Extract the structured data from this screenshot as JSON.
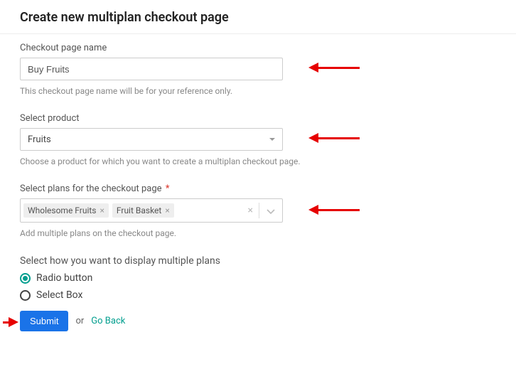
{
  "title": "Create new multiplan checkout page",
  "fields": {
    "name": {
      "label": "Checkout page name",
      "value": "Buy Fruits",
      "helper": "This checkout page name will be for your reference only."
    },
    "product": {
      "label": "Select product",
      "value": "Fruits",
      "helper": "Choose a product for which you want to create a multiplan checkout page."
    },
    "plans": {
      "label": "Select plans for the checkout page",
      "required_mark": "*",
      "chips": [
        "Wholesome Fruits",
        "Fruit Basket"
      ],
      "helper": "Add multiple plans on the checkout page."
    },
    "display": {
      "label": "Select how you want to display multiple plans",
      "options": [
        "Radio button",
        "Select Box"
      ],
      "selected": "Radio button"
    }
  },
  "actions": {
    "submit": "Submit",
    "or": "or",
    "go_back": "Go Back"
  }
}
